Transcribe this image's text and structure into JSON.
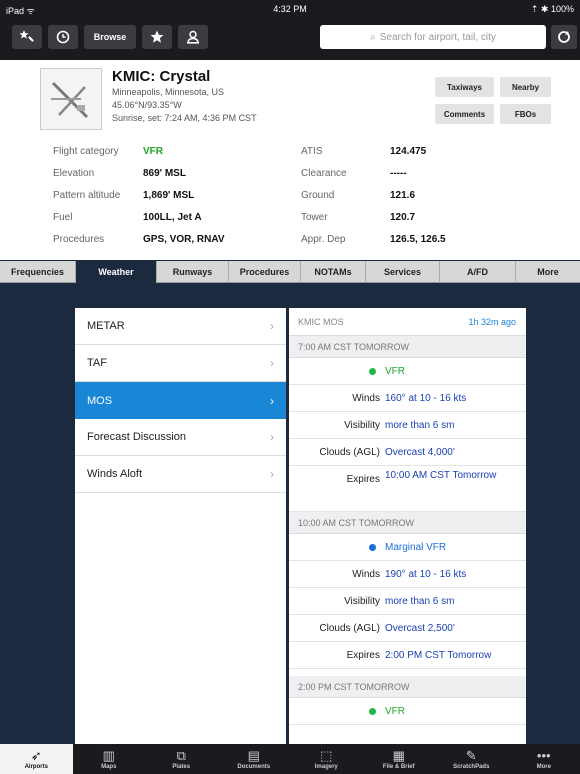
{
  "status": {
    "device": "iPad ᯤ",
    "time": "4:32 PM",
    "battery": "⇡ ✱ 100%"
  },
  "toolbar": {
    "icons": [
      "airport-star-icon",
      "clock-icon",
      "star-icon",
      "person-icon",
      "refresh-icon"
    ],
    "browse_label": "Browse",
    "search_placeholder": "Search for airport, tail, city"
  },
  "airport": {
    "title": "KMIC: Crystal",
    "location": "Minneapolis, Minnesota, US",
    "coords": "45.06°N/93.35°W",
    "sun": "Sunrise, set: 7:24 AM, 4:36 PM CST",
    "buttons": [
      "Taxiways",
      "Nearby",
      "Comments",
      "FBOs"
    ],
    "left_fields": [
      {
        "label": "Flight category",
        "value": "VFR"
      },
      {
        "label": "Elevation",
        "value": "869' MSL"
      },
      {
        "label": "Pattern altitude",
        "value": "1,869' MSL"
      },
      {
        "label": "Fuel",
        "value": "100LL, Jet A"
      },
      {
        "label": "Procedures",
        "value": "GPS, VOR, RNAV"
      }
    ],
    "right_fields": [
      {
        "label": "ATIS",
        "value": "124.475"
      },
      {
        "label": "Clearance",
        "value": "-----"
      },
      {
        "label": "Ground",
        "value": "121.6"
      },
      {
        "label": "Tower",
        "value": "120.7"
      },
      {
        "label": "Appr. Dep",
        "value": "126.5, 126.5"
      }
    ]
  },
  "tabs": [
    "Frequencies",
    "Weather",
    "Runways",
    "Procedures",
    "NOTAMs",
    "Services",
    "A/FD",
    "More"
  ],
  "active_tab": "Weather",
  "weather_menu": [
    "METAR",
    "TAF",
    "MOS",
    "Forecast Discussion",
    "Winds Aloft"
  ],
  "active_weather": "MOS",
  "mos": {
    "header": "KMIC MOS",
    "age": "1h 32m ago",
    "sections": [
      {
        "time": "7:00 AM CST TOMORROW",
        "category": "VFR",
        "category_color": "#22b54a",
        "rows": [
          {
            "label": "Winds",
            "value": "160° at 10 - 16 kts"
          },
          {
            "label": "Visibility",
            "value": "more than 6 sm"
          },
          {
            "label": "Clouds (AGL)",
            "value": "Overcast 4,000'"
          },
          {
            "label": "Expires",
            "value": "10:00 AM CST Tomorrow"
          }
        ]
      },
      {
        "time": "10:00 AM CST TOMORROW",
        "category": "Marginal VFR",
        "category_color": "#1a6fd6",
        "rows": [
          {
            "label": "Winds",
            "value": "190° at 10 - 16 kts"
          },
          {
            "label": "Visibility",
            "value": "more than 6 sm"
          },
          {
            "label": "Clouds (AGL)",
            "value": "Overcast 2,500'"
          },
          {
            "label": "Expires",
            "value": "2:00 PM CST Tomorrow"
          }
        ]
      },
      {
        "time": "2:00 PM CST TOMORROW",
        "category": "VFR",
        "category_color": "#22b54a",
        "rows": []
      }
    ]
  },
  "bottom_tabs": [
    {
      "label": "Airports",
      "icon": "airports-icon"
    },
    {
      "label": "Maps",
      "icon": "maps-icon"
    },
    {
      "label": "Plates",
      "icon": "plates-icon"
    },
    {
      "label": "Documents",
      "icon": "documents-icon"
    },
    {
      "label": "Imagery",
      "icon": "imagery-icon"
    },
    {
      "label": "File & Brief",
      "icon": "file-brief-icon"
    },
    {
      "label": "ScratchPads",
      "icon": "scratchpads-icon"
    },
    {
      "label": "More",
      "icon": "more-icon"
    }
  ],
  "active_bottom": "Airports"
}
